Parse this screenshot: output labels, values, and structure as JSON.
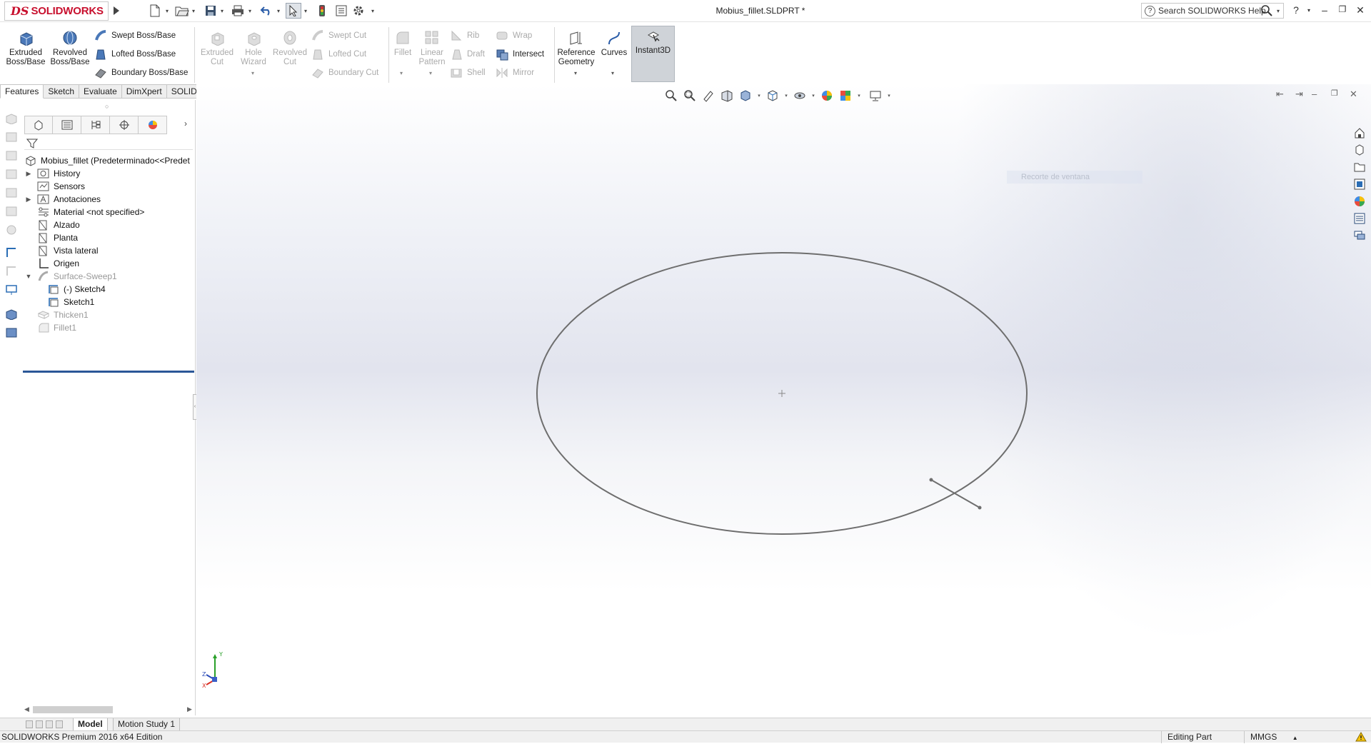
{
  "app": {
    "brand_prefix": "DS",
    "brand_name": "SOLIDWORKS",
    "document_title": "Mobius_fillet.SLDPRT *",
    "help_search_placeholder": "Search SOLIDWORKS Help"
  },
  "commands": {
    "extruded_boss": "Extruded Boss/Base",
    "revolved_boss": "Revolved Boss/Base",
    "swept_boss": "Swept Boss/Base",
    "lofted_boss": "Lofted Boss/Base",
    "boundary_boss": "Boundary Boss/Base",
    "extruded_cut": "Extruded Cut",
    "hole_wizard": "Hole Wizard",
    "revolved_cut": "Revolved Cut",
    "swept_cut": "Swept Cut",
    "lofted_cut": "Lofted Cut",
    "boundary_cut": "Boundary Cut",
    "fillet": "Fillet",
    "linear_pattern": "Linear Pattern",
    "rib": "Rib",
    "draft": "Draft",
    "shell": "Shell",
    "wrap": "Wrap",
    "intersect": "Intersect",
    "mirror": "Mirror",
    "reference_geometry": "Reference Geometry",
    "curves": "Curves",
    "instant3d": "Instant3D"
  },
  "tabs": [
    "Features",
    "Sketch",
    "Evaluate",
    "DimXpert",
    "SOLIDWORKS Add-Ins"
  ],
  "tree": {
    "root": "Mobius_fillet  (Predeterminado<<Predet",
    "items": [
      {
        "label": "History"
      },
      {
        "label": "Sensors"
      },
      {
        "label": "Anotaciones"
      },
      {
        "label": "Material <not specified>"
      },
      {
        "label": "Alzado"
      },
      {
        "label": "Planta"
      },
      {
        "label": "Vista lateral"
      },
      {
        "label": "Origen"
      },
      {
        "label": "Surface-Sweep1"
      },
      {
        "label": "(-) Sketch4"
      },
      {
        "label": "Sketch1"
      },
      {
        "label": "Thicken1"
      },
      {
        "label": "Fillet1"
      }
    ]
  },
  "graphics": {
    "ghost_label": "Recorte de ventana"
  },
  "bottom_tabs": [
    "Model",
    "Motion Study 1"
  ],
  "status": {
    "edition": "SOLIDWORKS Premium 2016 x64 Edition",
    "mode": "Editing Part",
    "units": "MMGS"
  },
  "colors": {
    "brand_red": "#c8102e",
    "rollback_bar": "#2b5797",
    "sketch_line": "#6e6e6e"
  }
}
